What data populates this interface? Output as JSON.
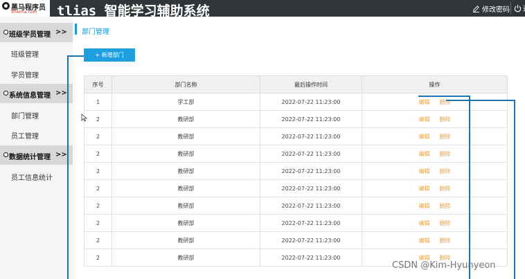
{
  "header": {
    "logo_name": "黑马程序员",
    "logo_url": "itheima.com",
    "app_title": "tlias 智能学习辅助系统",
    "change_password": "修改密码",
    "logout": "退出"
  },
  "sidebar": {
    "groups": [
      {
        "label": "班级学员管理",
        "arrow": ">>",
        "items": [
          "班级管理",
          "学员管理"
        ]
      },
      {
        "label": "系统信息管理",
        "arrow": ">>",
        "items": [
          "部门管理",
          "员工管理"
        ]
      },
      {
        "label": "数据统计管理",
        "arrow": ">>",
        "items": [
          "员工信息统计"
        ]
      }
    ]
  },
  "main": {
    "breadcrumb": "部门管理",
    "add_button": "+ 新增部门",
    "table": {
      "headers": [
        "序号",
        "部门名称",
        "最后操作时间",
        "操作"
      ],
      "edit_label": "编辑",
      "delete_label": "删除",
      "rows": [
        {
          "no": "1",
          "name": "学工部",
          "time": "2022-07-22 11:23:00"
        },
        {
          "no": "2",
          "name": "教研部",
          "time": "2022-07-22 11:23:00"
        },
        {
          "no": "2",
          "name": "教研部",
          "time": "2022-07-22 11:23:00"
        },
        {
          "no": "2",
          "name": "教研部",
          "time": "2022-07-22 11:23:00"
        },
        {
          "no": "2",
          "name": "教研部",
          "time": "2022-07-22 11:23:00"
        },
        {
          "no": "2",
          "name": "教研部",
          "time": "2022-07-22 11:23:00"
        },
        {
          "no": "2",
          "name": "教研部",
          "time": "2022-07-22 11:23:00"
        },
        {
          "no": "2",
          "name": "教研部",
          "time": "2022-07-22 11:23:00"
        },
        {
          "no": "2",
          "name": "教研部",
          "time": "2022-07-22 11:23:00"
        },
        {
          "no": "2",
          "name": "教研部",
          "time": "2022-07-22 11:23:00"
        }
      ]
    }
  },
  "watermark": "CSDN @Kim-Hyunyeon",
  "colors": {
    "accent": "#1a9ad6",
    "header_bg": "#2f3538",
    "action": "#f0a030"
  }
}
